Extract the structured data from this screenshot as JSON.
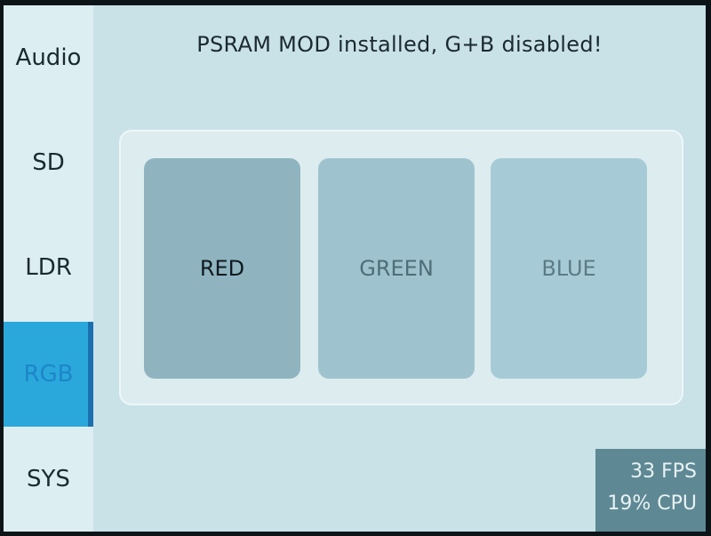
{
  "sidebar": {
    "tabs": [
      {
        "label": "Audio"
      },
      {
        "label": "SD"
      },
      {
        "label": "LDR"
      },
      {
        "label": "RGB",
        "active": true
      },
      {
        "label": "SYS"
      }
    ]
  },
  "main": {
    "title": "PSRAM MOD installed, G+B disabled!",
    "buttons": {
      "red": "RED",
      "green": "GREEN",
      "blue": "BLUE"
    }
  },
  "stats": {
    "fps": "33 FPS",
    "cpu": "19% CPU"
  },
  "colors": {
    "background": "#c9e2e8",
    "sidebar": "#ddeef2",
    "active_tab": "#2aa8dc",
    "stats_bg": "#5e8994"
  }
}
